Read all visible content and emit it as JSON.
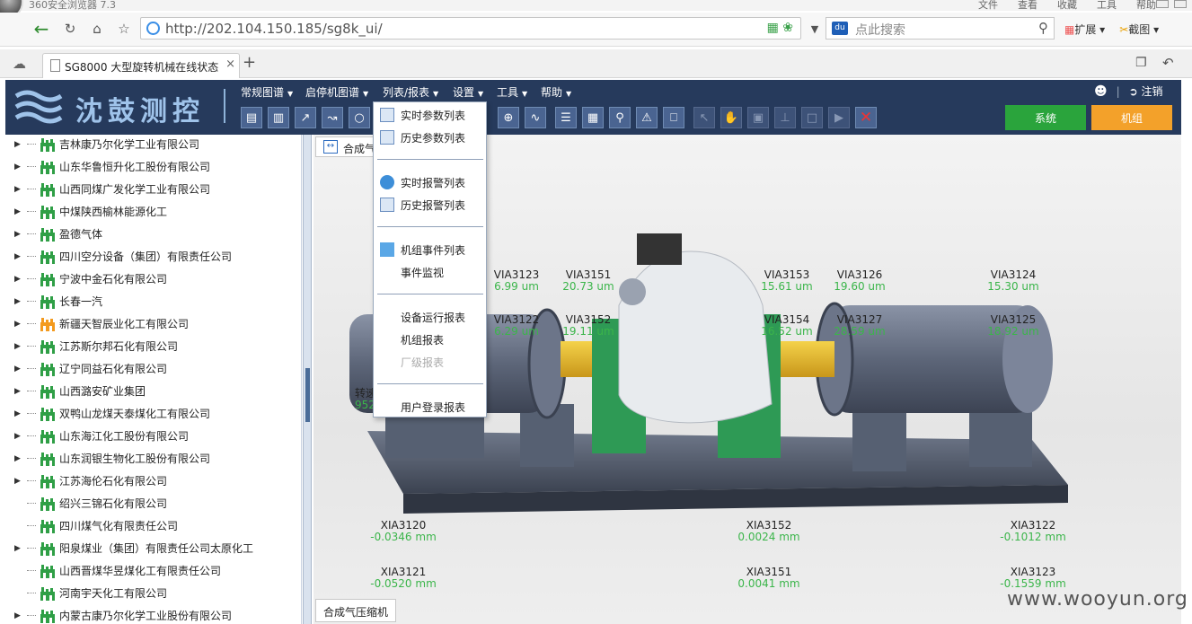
{
  "browser": {
    "name": "360安全浏览器 7.3",
    "menu": [
      "文件",
      "查看",
      "收藏",
      "工具",
      "帮助"
    ],
    "url": "http://202.104.150.185/sg8k_ui/",
    "search_placeholder": "点此搜索",
    "ext_label": "扩展",
    "shot_label": "截图",
    "tab_title": "SG8000 大型旋转机械在线状态"
  },
  "app": {
    "logo": "沈鼓测控",
    "menu": [
      "常规图谱",
      "启停机图谱",
      "列表/报表",
      "设置",
      "工具",
      "帮助"
    ],
    "logout": "注销",
    "btn_system": "系统",
    "btn_unit": "机组",
    "content_tab": "合成气",
    "bottom_tab": "合成气压缩机",
    "speed_label": "转速",
    "speed_value": "9523 r"
  },
  "sidebar": [
    "吉林康乃尔化学工业有限公司",
    "山东华鲁恒升化工股份有限公司",
    "山西同煤广发化学工业有限公司",
    "中煤陕西榆林能源化工",
    "盈德气体",
    "四川空分设备（集团）有限责任公司",
    "宁波中金石化有限公司",
    "长春一汽",
    "新疆天智辰业化工有限公司",
    "江苏斯尔邦石化有限公司",
    "辽宁同益石化有限公司",
    "山西潞安矿业集团",
    "双鸭山龙煤天泰煤化工有限公司",
    "山东海江化工股份有限公司",
    "山东润银生物化工股份有限公司",
    "江苏海伦石化有限公司",
    "绍兴三锦石化有限公司",
    "四川煤气化有限责任公司",
    "阳泉煤业（集团）有限责任公司太原化工",
    "山西晋煤华昱煤化工有限责任公司",
    "河南宇天化工有限公司",
    "内蒙古康乃尔化学工业股份有限公司"
  ],
  "dropdown": [
    "实时参数列表",
    "历史参数列表",
    "实时报警列表",
    "历史报警列表",
    "机组事件列表",
    "事件监视",
    "设备运行报表",
    "机组报表",
    "厂级报表",
    "用户登录报表"
  ],
  "sensors_top": [
    {
      "n": "VIA3123",
      "v": "6.99 um"
    },
    {
      "n": "VIA3151",
      "v": "20.73 um"
    },
    {
      "n": "VIA3153",
      "v": "15.61 um"
    },
    {
      "n": "VIA3126",
      "v": "19.60 um"
    },
    {
      "n": "VIA3124",
      "v": "15.30 um"
    },
    {
      "n": "VIA3122",
      "v": "6.29 um"
    },
    {
      "n": "VIA3152",
      "v": "19.11 um"
    },
    {
      "n": "VIA3154",
      "v": "16.52 um"
    },
    {
      "n": "VIA3127",
      "v": "28.59 um"
    },
    {
      "n": "VIA3125",
      "v": "18.92 um"
    }
  ],
  "sensors_bottom": [
    {
      "n": "XIA3120",
      "v": "-0.0346 mm"
    },
    {
      "n": "XIA3152",
      "v": "0.0024 mm"
    },
    {
      "n": "XIA3122",
      "v": "-0.1012 mm"
    },
    {
      "n": "XIA3121",
      "v": "-0.0520 mm"
    },
    {
      "n": "XIA3151",
      "v": "0.0041 mm"
    },
    {
      "n": "XIA3123",
      "v": "-0.1559 mm"
    }
  ],
  "watermark": "www.wooyun.org",
  "colors": {
    "header": "#263a5c",
    "green": "#2aa43c",
    "orange": "#f3a12a",
    "value": "#3bb54a"
  }
}
